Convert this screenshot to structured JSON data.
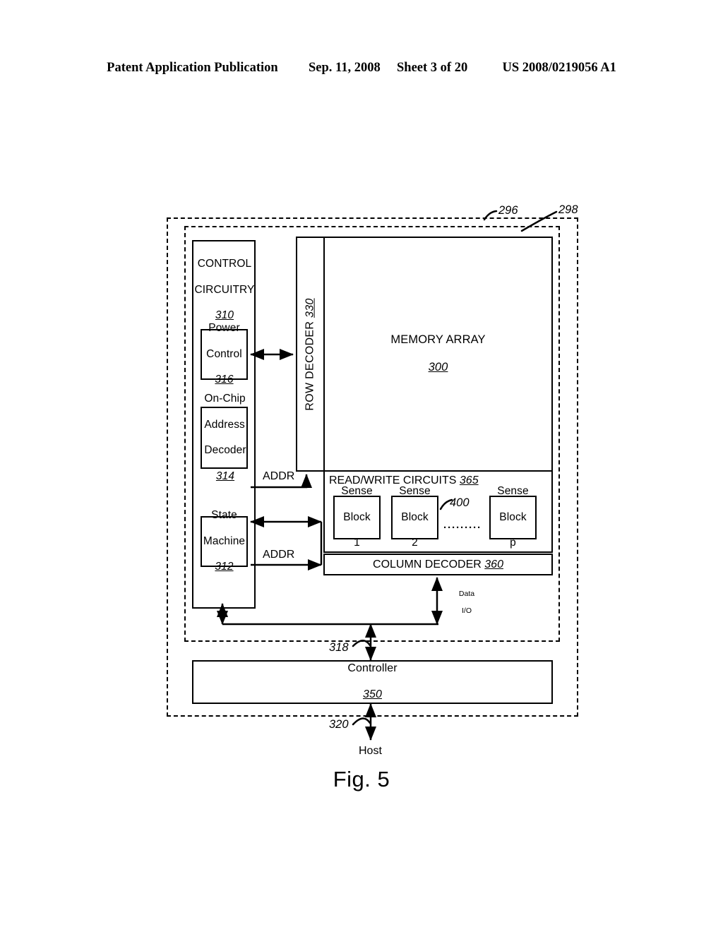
{
  "header": {
    "publication": "Patent Application Publication",
    "date": "Sep. 11, 2008",
    "sheet": "Sheet 3 of 20",
    "patent_number": "US 2008/0219056 A1"
  },
  "figure": {
    "caption": "Fig. 5",
    "boundaries": [
      {
        "ref": "296"
      },
      {
        "ref": "298"
      }
    ],
    "control_circuitry": {
      "title_line1": "CONTROL",
      "title_line2": "CIRCUITRY",
      "ref": "310"
    },
    "power_control": {
      "line1": "Power",
      "line2": "Control",
      "ref": "316"
    },
    "address_decoder": {
      "line1": "On-Chip",
      "line2": "Address",
      "line3": "Decoder",
      "ref": "314"
    },
    "state_machine": {
      "line1": "State",
      "line2": "Machine",
      "ref": "312"
    },
    "row_decoder": {
      "label": "ROW DECODER",
      "ref": "330"
    },
    "memory_array": {
      "label": "MEMORY ARRAY",
      "ref": "300"
    },
    "read_write_circuits": {
      "label": "READ/WRITE CIRCUITS",
      "ref": "365",
      "sense_blocks_ref": "400",
      "sense_blocks": [
        {
          "line1": "Sense",
          "line2": "Block",
          "index": "1"
        },
        {
          "line1": "Sense",
          "line2": "Block",
          "index": "2"
        },
        {
          "line1": "Sense",
          "line2": "Block",
          "index": "p"
        }
      ],
      "ellipsis": "·········"
    },
    "column_decoder": {
      "label": "COLUMN DECODER",
      "ref": "360"
    },
    "data_io": {
      "line1": "Data",
      "line2": "I/O"
    },
    "addr_upper": "ADDR",
    "addr_lower": "ADDR",
    "bus_318": "318",
    "bus_320": "320",
    "controller": {
      "label": "Controller",
      "ref": "350"
    },
    "host": {
      "label": "Host"
    }
  }
}
